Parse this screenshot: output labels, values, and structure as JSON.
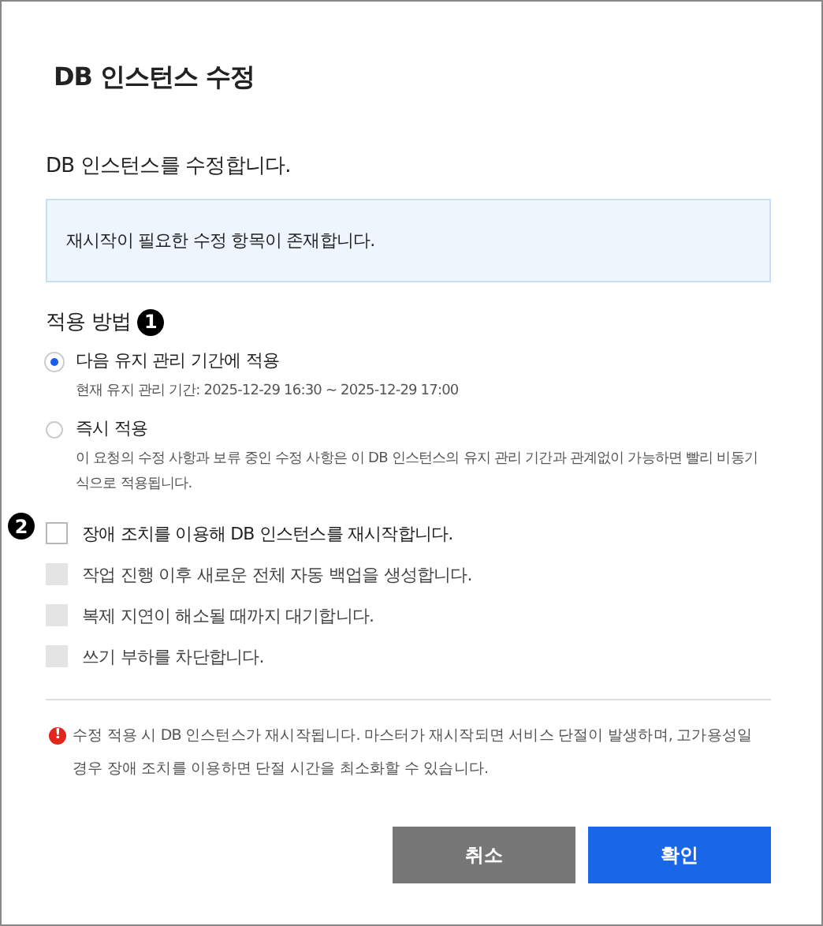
{
  "dialog": {
    "title": "DB 인스턴스 수정",
    "subtitle": "DB 인스턴스를 수정합니다.",
    "info": "재시작이 필요한 수정 항목이 존재합니다."
  },
  "apply_method": {
    "label": "적용 방법",
    "marker": "1",
    "options": [
      {
        "label": "다음 유지 관리 기간에 적용",
        "description": "현재 유지 관리 기간: 2025-12-29 16:30 ~ 2025-12-29 17:00",
        "selected": true
      },
      {
        "label": "즉시 적용",
        "description": "이 요청의 수정 사항과 보류 중인 수정 사항은 이 DB 인스턴스의 유지 관리 기간과 관계없이 가능하면 빨리 비동기식으로 적용됩니다.",
        "selected": false
      }
    ]
  },
  "options": {
    "marker": "2",
    "items": [
      {
        "label": "장애 조치를 이용해 DB 인스턴스를 재시작합니다.",
        "checked": false,
        "disabled": false
      },
      {
        "label": "작업 진행 이후 새로운 전체 자동 백업을 생성합니다.",
        "checked": false,
        "disabled": true
      },
      {
        "label": "복제 지연이 해소될 때까지 대기합니다.",
        "checked": false,
        "disabled": true
      },
      {
        "label": "쓰기 부하를 차단합니다.",
        "checked": false,
        "disabled": true
      }
    ]
  },
  "warning": {
    "icon": "!",
    "text": "수정 적용 시 DB 인스턴스가 재시작됩니다. 마스터가 재시작되면 서비스 단절이 발생하며, 고가용성일 경우 장애 조치를 이용하면 단절 시간을 최소화할 수 있습니다."
  },
  "buttons": [
    {
      "label": "취소",
      "kind": "secondary"
    },
    {
      "label": "확인",
      "kind": "primary"
    }
  ]
}
